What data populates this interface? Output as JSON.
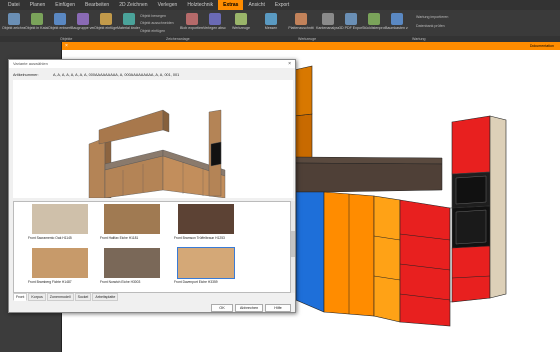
{
  "menu": [
    "Datei",
    "Planen",
    "Einfügen",
    "Bearbeiten",
    "2D Zeichnen",
    "Verlegen",
    "Holztechnik",
    "Extras",
    "Ansicht",
    "Export"
  ],
  "menu_active_index": 7,
  "ribbon": {
    "objekte": [
      "Objekt zeichnen",
      "Objekt in Katalog",
      "Objekt entwerfen",
      "Baugruppe verwalten",
      "Objekt einfügen",
      "Material ändern"
    ],
    "small": [
      "Objekt bewegen",
      "Objekt ausschneiden",
      "Objekt einfügen"
    ],
    "mid": [
      "Blob exportieren",
      "Verlegen abschneiden"
    ],
    "werkzeuge": [
      "Werkzeuge",
      "Messen",
      "Plattenzuschnitt"
    ],
    "extra": [
      "Kantenanalyse",
      "3D PDF Exportieren",
      "Stücklistenprotokoll",
      "Baumkasten zuordnen"
    ],
    "wartung": [
      "Wartung importieren",
      "Datenbank prüfen"
    ]
  },
  "groups": [
    "Objekte",
    "Zeichenanlage",
    "Werkzeuge",
    "Wartung"
  ],
  "doc_title": "Dokumentation",
  "dialog": {
    "title": "Variante auswählen",
    "artnum_label": "Artikelnummer:",
    "artnum_value": "A, A, A, A, A, A, A, A, 000AAAAAAAAA, A, 000AAAAAAAAA, A, A, 001, 001",
    "thumbs": [
      {
        "label": "Front Sacramento Oak H1145",
        "color": "#cfc0aa"
      },
      {
        "label": "Front Halifax Eiche H1181",
        "color": "#a07a52"
      },
      {
        "label": "Front Bramson Trüffelbraun H1253",
        "color": "#5c4234"
      },
      {
        "label": "Front Bramberg Fichte H1487",
        "color": "#c79a6a"
      },
      {
        "label": "Front Norwich Eiche H3003",
        "color": "#7a6858"
      },
      {
        "label": "Front Davenport Eiche H3359",
        "color": "#d4a877"
      }
    ],
    "tabs": [
      "Front",
      "Korpus",
      "Zonenmodell",
      "Sockel",
      "Arbeitsplatte"
    ],
    "ok": "OK",
    "cancel": "Abbrechen",
    "help": "Hilfe"
  }
}
